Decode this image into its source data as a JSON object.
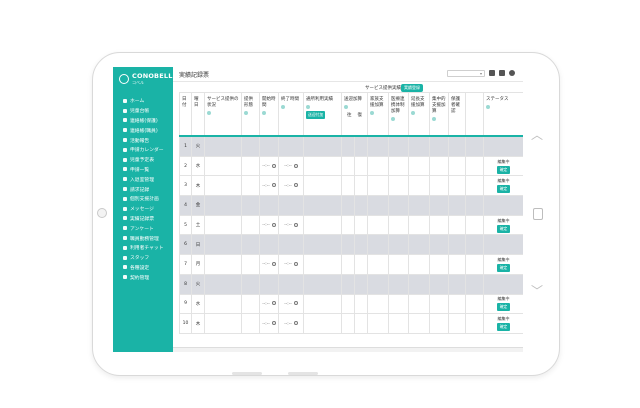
{
  "app": {
    "brand": "CONOBELL",
    "brand_sub": "コベル"
  },
  "header": {
    "title": "実績記録票",
    "select_value": "▾"
  },
  "service_banner": {
    "label": "サービス提供実績",
    "badge": "実績登録"
  },
  "sidebar": {
    "items": [
      {
        "label": "ホーム",
        "icon": "home-icon"
      },
      {
        "label": "児童台帳",
        "icon": "child-icon"
      },
      {
        "label": "連絡帳(保護)",
        "icon": "notebook-icon"
      },
      {
        "label": "連絡帳(職員)",
        "icon": "notebook-icon"
      },
      {
        "label": "活動報告",
        "icon": "report-icon"
      },
      {
        "label": "申請カレンダー",
        "icon": "calendar-icon"
      },
      {
        "label": "児童予定表",
        "icon": "schedule-icon"
      },
      {
        "label": "申請一覧",
        "icon": "list-icon"
      },
      {
        "label": "入退室管理",
        "icon": "door-icon"
      },
      {
        "label": "請求記録",
        "icon": "invoice-icon"
      },
      {
        "label": "個別支援計画",
        "icon": "plan-icon"
      },
      {
        "label": "メッセージ",
        "icon": "message-icon"
      },
      {
        "label": "実績記録票",
        "icon": "record-icon"
      },
      {
        "label": "アンケート",
        "icon": "survey-icon"
      },
      {
        "label": "職員勤務管理",
        "icon": "staff-icon"
      },
      {
        "label": "利用者チャット",
        "icon": "chat-icon"
      },
      {
        "label": "スタッフ",
        "icon": "user-icon"
      },
      {
        "label": "各種設定",
        "icon": "gear-icon"
      },
      {
        "label": "契約管理",
        "icon": "contract-icon"
      }
    ]
  },
  "table": {
    "headers": {
      "date": "日付",
      "weekday": "曜日",
      "service": "サービス提供の状況",
      "extension": "提供形態",
      "start": "開始時間",
      "end": "終了時間",
      "transport": "通所利用実績",
      "transport_btn": "送迎付加",
      "pickup": "送迎加算",
      "pickup_out": "往",
      "pickup_ret": "復",
      "family": "家族支援加算",
      "medical": "医療連携体制加算",
      "additional": "延長支援加算",
      "specialist": "集中的支援加算",
      "guardian": "保護者確認",
      "status": "ステータス"
    },
    "rows": [
      {
        "day": "1",
        "wd": "火",
        "type": "gray"
      },
      {
        "day": "2",
        "wd": "水",
        "type": "normal",
        "start": "--:--",
        "end": "--:--",
        "status": "編集中",
        "btn": "確定"
      },
      {
        "day": "3",
        "wd": "木",
        "type": "normal",
        "start": "--:--",
        "end": "--:--",
        "status": "編集中",
        "btn": "確定"
      },
      {
        "day": "4",
        "wd": "金",
        "type": "gray"
      },
      {
        "day": "5",
        "wd": "土",
        "type": "normal",
        "cls": "sat",
        "start": "--:--",
        "end": "--:--",
        "status": "編集中",
        "btn": "確定"
      },
      {
        "day": "6",
        "wd": "日",
        "type": "gray",
        "cls": "sun"
      },
      {
        "day": "7",
        "wd": "月",
        "type": "normal",
        "start": "--:--",
        "end": "--:--",
        "status": "編集中",
        "btn": "確定"
      },
      {
        "day": "8",
        "wd": "火",
        "type": "gray"
      },
      {
        "day": "9",
        "wd": "水",
        "type": "normal",
        "start": "--:--",
        "end": "--:--",
        "status": "編集中",
        "btn": "確定"
      },
      {
        "day": "10",
        "wd": "木",
        "type": "normal",
        "start": "--:--",
        "end": "--:--",
        "status": "編集中",
        "btn": "確定"
      }
    ]
  },
  "colors": {
    "accent": "#1ab3a6",
    "gray_row": "#d9dbe1"
  }
}
